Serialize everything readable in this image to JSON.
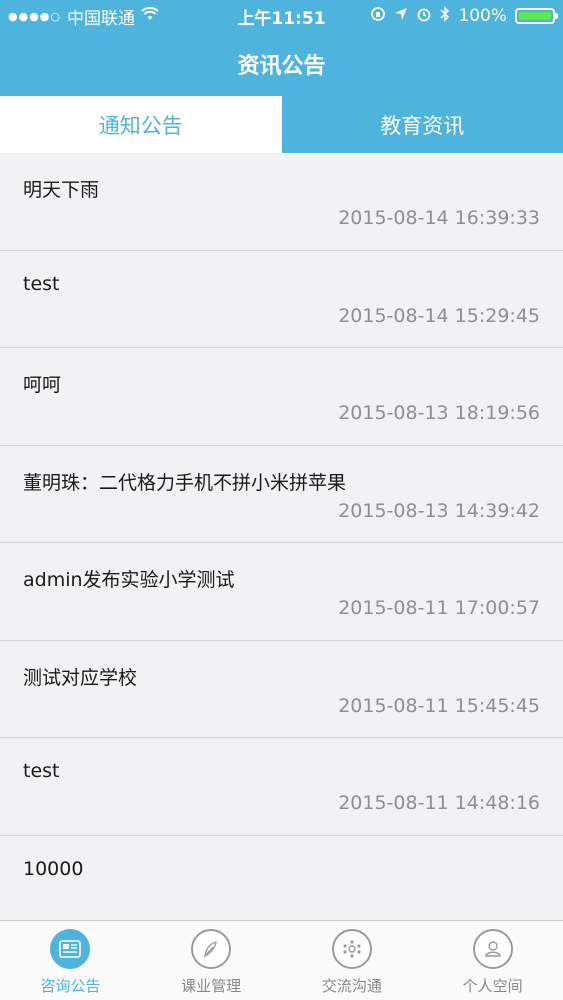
{
  "status_bar": {
    "signal": "●●●●○",
    "carrier": "中国联通",
    "wifi_icon": "wifi-icon",
    "time": "上午11:51",
    "battery_percent": "100%",
    "battery_level": 1.0,
    "battery_color": "#5de84f"
  },
  "header": {
    "title": "资讯公告"
  },
  "tabs": [
    {
      "label": "通知公告",
      "active": true
    },
    {
      "label": "教育资讯",
      "active": false
    }
  ],
  "list": [
    {
      "title": "明天下雨",
      "time": "2015-08-14 16:39:33"
    },
    {
      "title": "test",
      "time": "2015-08-14 15:29:45"
    },
    {
      "title": "呵呵",
      "time": "2015-08-13 18:19:56"
    },
    {
      "title": "董明珠：二代格力手机不拼小米拼苹果",
      "time": "2015-08-13 14:39:42"
    },
    {
      "title": "admin发布实验小学测试",
      "time": "2015-08-11 17:00:57"
    },
    {
      "title": "测试对应学校",
      "time": "2015-08-11 15:45:45"
    },
    {
      "title": "test",
      "time": "2015-08-11 14:48:16"
    },
    {
      "title": "10000",
      "time": ""
    }
  ],
  "tabbar": [
    {
      "label": "咨询公告",
      "icon": "news-icon",
      "active": true
    },
    {
      "label": "课业管理",
      "icon": "feather-icon",
      "active": false
    },
    {
      "label": "交流沟通",
      "icon": "network-icon",
      "active": false
    },
    {
      "label": "个人空间",
      "icon": "person-icon",
      "active": false
    }
  ],
  "colors": {
    "accent": "#4eb3dd",
    "background": "#f2f2f4",
    "secondary_text": "#8e8e93"
  }
}
